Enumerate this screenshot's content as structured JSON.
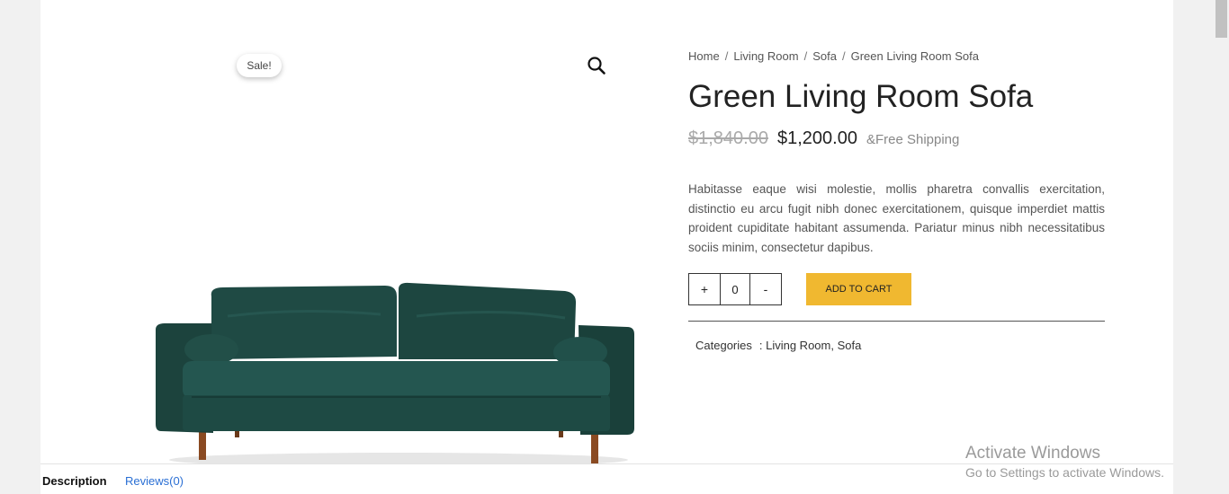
{
  "gallery": {
    "sale_label": "Sale!",
    "zoom_icon": "search-icon"
  },
  "breadcrumb": {
    "items": [
      "Home",
      "Living Room",
      "Sofa",
      "Green Living Room Sofa"
    ],
    "separator": "/"
  },
  "product": {
    "title": "Green Living Room Sofa",
    "price_old": "$1,840.00",
    "price_new": "$1,200.00",
    "shipping": "&Free Shipping",
    "description": "Habitasse eaque wisi molestie, mollis pharetra convallis exercitation, distinctio eu arcu fugit nibh donec exercitationem, quisque imperdiet mattis proident cupiditate habitant assumenda. Pariatur minus nibh necessitatibus sociis minim, consectetur dapibus."
  },
  "cart": {
    "increment_label": "+",
    "quantity": "0",
    "decrement_label": "-",
    "add_to_cart_label": "ADD TO CART",
    "button_color": "#f0b830"
  },
  "meta": {
    "categories_label": "Categories",
    "categories_value": ": Living Room, Sofa"
  },
  "tabs": {
    "description_label": "Description",
    "reviews_label": "Reviews(0)"
  },
  "watermark": {
    "title": "Activate Windows",
    "subtitle": "Go to Settings to activate Windows."
  }
}
